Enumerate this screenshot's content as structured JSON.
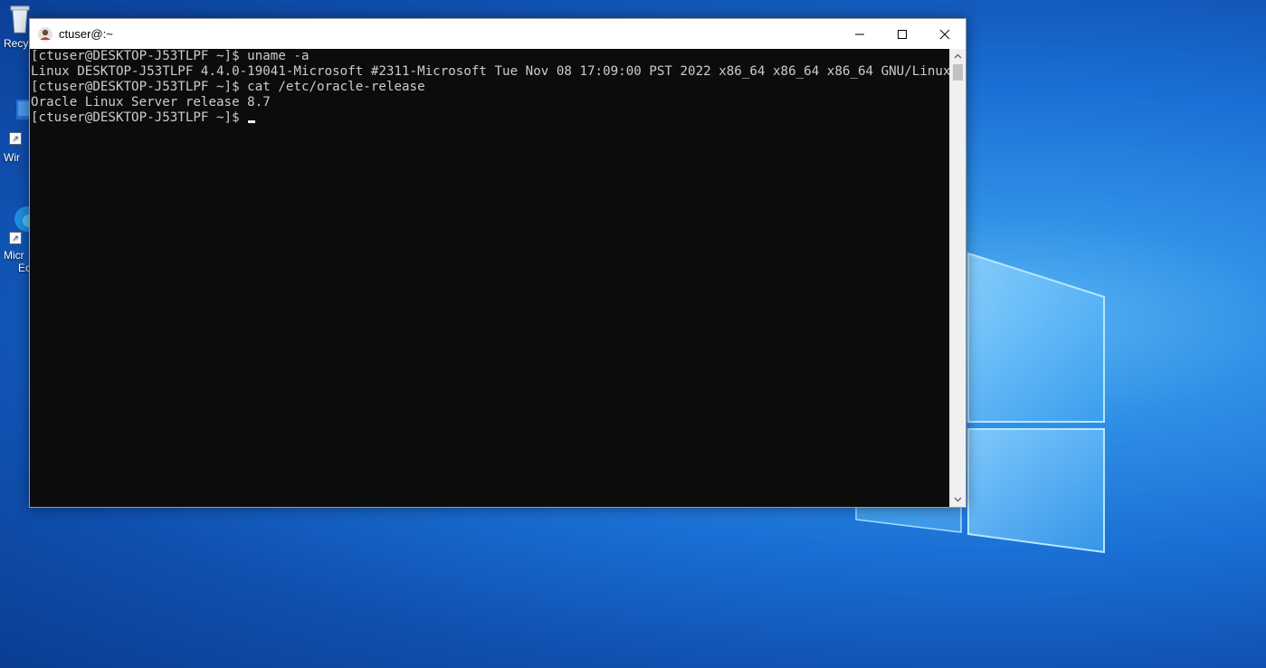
{
  "desktop": {
    "icons": [
      {
        "label": "Recy",
        "icon": "recycle-bin-icon"
      },
      {
        "label": "Wir",
        "icon": "windows-shortcut-icon"
      },
      {
        "label": "Micr",
        "label2": "Ec",
        "icon": "edge-icon"
      }
    ],
    "colors": {
      "background": "#1a6fd4",
      "logo": "#7cc8ff"
    }
  },
  "window": {
    "title": "ctuser@:~",
    "controls": {
      "minimize": "minimize-icon",
      "maximize": "maximize-icon",
      "close": "close-icon"
    }
  },
  "terminal": {
    "lines": [
      "[ctuser@DESKTOP-J53TLPF ~]$ uname -a",
      "Linux DESKTOP-J53TLPF 4.4.0-19041-Microsoft #2311-Microsoft Tue Nov 08 17:09:00 PST 2022 x86_64 x86_64 x86_64 GNU/Linux",
      "[ctuser@DESKTOP-J53TLPF ~]$ cat /etc/oracle-release",
      "Oracle Linux Server release 8.7",
      "[ctuser@DESKTOP-J53TLPF ~]$ "
    ],
    "colors": {
      "background": "#0c0c0c",
      "text": "#cccccc"
    }
  }
}
